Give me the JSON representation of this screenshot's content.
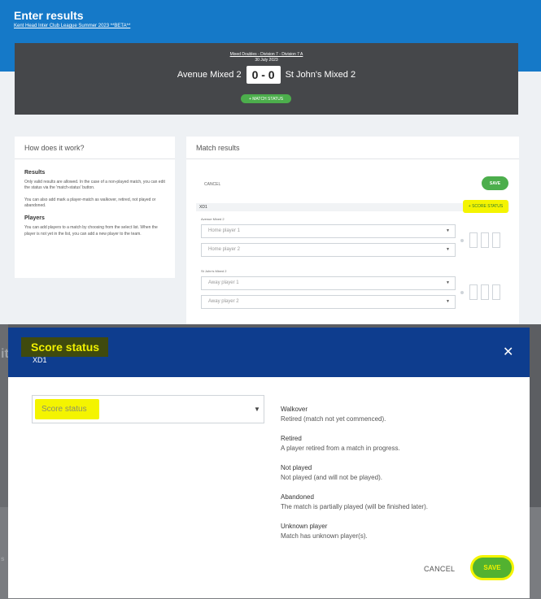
{
  "header": {
    "title": "Enter results",
    "league_link": "Kent Head Inter Club League Summer 2023 **BETA**"
  },
  "match": {
    "event_link": "Mixed Doubles - Division 7 - Division 7 A",
    "date": "30 July 2023",
    "home_team": "Avenue Mixed 2",
    "score": "0 - 0",
    "away_team": "St John's Mixed 2",
    "status_button": "MATCH STATUS"
  },
  "help": {
    "heading": "How does it work?",
    "results_title": "Results",
    "results_p1": "Only valid results are allowed. In the case of a non-played match, you can edit the status via the 'match-status' button.",
    "results_p2": "You can also add mark a player-match as walkover, retired, not played or abandoned.",
    "players_title": "Players",
    "players_p1": "You can add players to a match by choosing from the select list. When the player is not yet in the list, you can add a new player to the team."
  },
  "results": {
    "heading": "Match results",
    "cancel_label": "CANCEL",
    "save_label": "SAVE",
    "row_label": "XD1",
    "score_status_label": "+ SCORE STATUS",
    "home_label": "Avenue Mixed 2",
    "home_player1": "Home player 1",
    "home_player2": "Home player 2",
    "away_label": "St John's Mixed 2",
    "away_player1": "Away player 1",
    "away_player2": "Away player 2"
  },
  "modal": {
    "title": "Score status",
    "subtitle": "XD1",
    "close_icon": "close-icon",
    "select_placeholder": "Score status",
    "definitions": [
      {
        "term": "Walkover",
        "desc": "Retired (match not yet commenced)."
      },
      {
        "term": "Retired",
        "desc": "A player retired from a match in progress."
      },
      {
        "term": "Not played",
        "desc": "Not played (and will not be played)."
      },
      {
        "term": "Abandoned",
        "desc": "The match is partially played (will be finished later)."
      },
      {
        "term": "Unknown player",
        "desc": "Match has unknown player(s)."
      }
    ],
    "cancel_label": "CANCEL",
    "save_label": "SAVE"
  },
  "colors": {
    "header_blue": "#1579c8",
    "modal_header": "#0e3d8e",
    "accent_green": "#4cae4c",
    "highlight": "#f4f400"
  }
}
